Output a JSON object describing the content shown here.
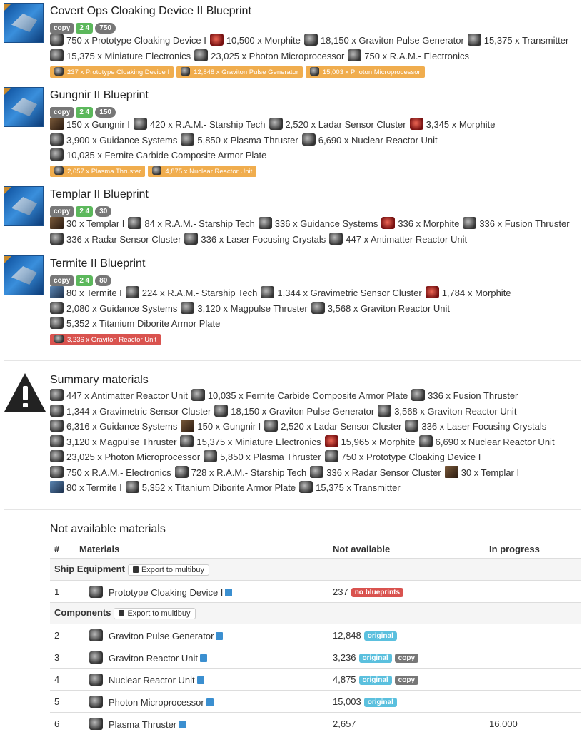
{
  "blueprints": [
    {
      "title": "Covert Ops Cloaking Device II Blueprint",
      "badges": [
        "copy",
        "2 4",
        "750"
      ],
      "materials": [
        "750 x Prototype Cloaking Device I",
        "10,500 x Morphite",
        "18,150 x Graviton Pulse Generator",
        "15,375 x Transmitter",
        "15,375 x Miniature Electronics",
        "23,025 x Photon Microprocessor",
        "750 x R.A.M.- Electronics"
      ],
      "tags": [
        {
          "text": "237 x Prototype Cloaking Device I",
          "color": "orange"
        },
        {
          "text": "12,848 x Graviton Pulse Generator",
          "color": "orange"
        },
        {
          "text": "15,003 x Photon Microprocessor",
          "color": "orange"
        }
      ]
    },
    {
      "title": "Gungnir II Blueprint",
      "badges": [
        "copy",
        "2 4",
        "150"
      ],
      "materials": [
        "150 x Gungnir I",
        "420 x R.A.M.- Starship Tech",
        "2,520 x Ladar Sensor Cluster",
        "3,345 x Morphite",
        "3,900 x Guidance Systems",
        "5,850 x Plasma Thruster",
        "6,690 x Nuclear Reactor Unit",
        "10,035 x Fernite Carbide Composite Armor Plate"
      ],
      "tags": [
        {
          "text": "2,657 x Plasma Thruster",
          "color": "orange"
        },
        {
          "text": "4,875 x Nuclear Reactor Unit",
          "color": "orange"
        }
      ]
    },
    {
      "title": "Templar II Blueprint",
      "badges": [
        "copy",
        "2 4",
        "30"
      ],
      "materials": [
        "30 x Templar I",
        "84 x R.A.M.- Starship Tech",
        "336 x Guidance Systems",
        "336 x Morphite",
        "336 x Fusion Thruster",
        "336 x Radar Sensor Cluster",
        "336 x Laser Focusing Crystals",
        "447 x Antimatter Reactor Unit"
      ],
      "tags": []
    },
    {
      "title": "Termite II Blueprint",
      "badges": [
        "copy",
        "2 4",
        "80"
      ],
      "materials": [
        "80 x Termite I",
        "224 x R.A.M.- Starship Tech",
        "1,344 x Gravimetric Sensor Cluster",
        "1,784 x Morphite",
        "2,080 x Guidance Systems",
        "3,120 x Magpulse Thruster",
        "3,568 x Graviton Reactor Unit",
        "5,352 x Titanium Diborite Armor Plate"
      ],
      "tags": [
        {
          "text": "3,236 x Graviton Reactor Unit",
          "color": "red"
        }
      ]
    }
  ],
  "summary": {
    "title": "Summary materials",
    "materials": [
      "447 x Antimatter Reactor Unit",
      "10,035 x Fernite Carbide Composite Armor Plate",
      "336 x Fusion Thruster",
      "1,344 x Gravimetric Sensor Cluster",
      "18,150 x Graviton Pulse Generator",
      "3,568 x Graviton Reactor Unit",
      "6,316 x Guidance Systems",
      "150 x Gungnir I",
      "2,520 x Ladar Sensor Cluster",
      "336 x Laser Focusing Crystals",
      "3,120 x Magpulse Thruster",
      "15,375 x Miniature Electronics",
      "15,965 x Morphite",
      "6,690 x Nuclear Reactor Unit",
      "23,025 x Photon Microprocessor",
      "5,850 x Plasma Thruster",
      "750 x Prototype Cloaking Device I",
      "750 x R.A.M.- Electronics",
      "728 x R.A.M.- Starship Tech",
      "336 x Radar Sensor Cluster",
      "30 x Templar I",
      "80 x Termite I",
      "5,352 x Titanium Diborite Armor Plate",
      "15,375 x Transmitter"
    ]
  },
  "not_available": {
    "title": "Not available materials",
    "headers": [
      "#",
      "Materials",
      "Not available",
      "In progress"
    ],
    "export_label": "Export to multibuy",
    "groups": [
      {
        "name": "Ship Equipment",
        "rows": [
          {
            "n": "1",
            "name": "Prototype Cloaking Device I",
            "qty": "237",
            "labels": [
              {
                "t": "no blueprints",
                "c": "danger"
              }
            ],
            "progress": ""
          }
        ]
      },
      {
        "name": "Components",
        "rows": [
          {
            "n": "2",
            "name": "Graviton Pulse Generator",
            "qty": "12,848",
            "labels": [
              {
                "t": "original",
                "c": "info"
              }
            ],
            "progress": ""
          },
          {
            "n": "3",
            "name": "Graviton Reactor Unit",
            "qty": "3,236",
            "labels": [
              {
                "t": "original",
                "c": "info"
              },
              {
                "t": "copy",
                "c": "def"
              }
            ],
            "progress": ""
          },
          {
            "n": "4",
            "name": "Nuclear Reactor Unit",
            "qty": "4,875",
            "labels": [
              {
                "t": "original",
                "c": "info"
              },
              {
                "t": "copy",
                "c": "def"
              }
            ],
            "progress": ""
          },
          {
            "n": "5",
            "name": "Photon Microprocessor",
            "qty": "15,003",
            "labels": [
              {
                "t": "original",
                "c": "info"
              }
            ],
            "progress": ""
          },
          {
            "n": "6",
            "name": "Plasma Thruster",
            "qty": "2,657",
            "labels": [],
            "progress": "16,000"
          }
        ]
      }
    ]
  }
}
